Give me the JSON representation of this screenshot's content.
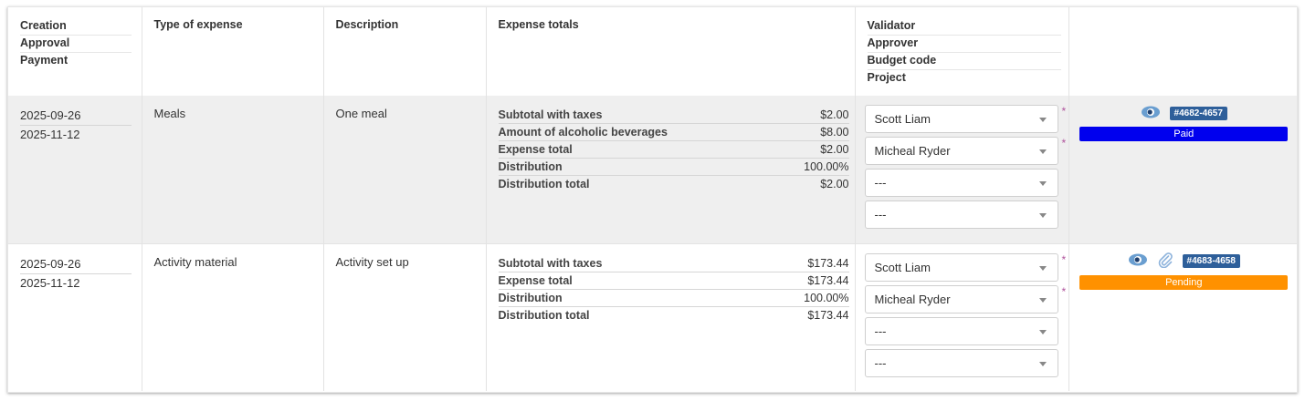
{
  "header": {
    "col1": [
      "Creation",
      "Approval",
      "Payment"
    ],
    "col2": "Type of expense",
    "col3": "Description",
    "col4": "Expense totals",
    "col5": [
      "Validator",
      "Approver",
      "Budget code",
      "Project"
    ]
  },
  "rows": [
    {
      "dates": [
        "2025-09-26",
        "2025-11-12"
      ],
      "type": "Meals",
      "description": "One meal",
      "totals": [
        {
          "label": "Subtotal with taxes",
          "value": "$2.00"
        },
        {
          "label": "Amount of alcoholic beverages",
          "value": "$8.00"
        },
        {
          "label": "Expense total",
          "value": "$2.00"
        },
        {
          "label": "Distribution",
          "value": "100.00%"
        },
        {
          "label": "Distribution total",
          "value": "$2.00"
        }
      ],
      "validator": "Scott Liam",
      "approver": "Micheal Ryder",
      "budget_code": "---",
      "project": "---",
      "ref": "#4682-4657",
      "status": "Paid",
      "status_color": "#0000ee",
      "has_attachment": false
    },
    {
      "dates": [
        "2025-09-26",
        "2025-11-12"
      ],
      "type": "Activity material",
      "description": "Activity set up",
      "totals": [
        {
          "label": "Subtotal with taxes",
          "value": "$173.44"
        },
        {
          "label": "Expense total",
          "value": "$173.44"
        },
        {
          "label": "Distribution",
          "value": "100.00%"
        },
        {
          "label": "Distribution total",
          "value": "$173.44"
        }
      ],
      "validator": "Scott Liam",
      "approver": "Micheal Ryder",
      "budget_code": "---",
      "project": "---",
      "ref": "#4683-4658",
      "status": "Pending",
      "status_color": "#ff9100",
      "has_attachment": true
    }
  ],
  "required_marker": "*"
}
